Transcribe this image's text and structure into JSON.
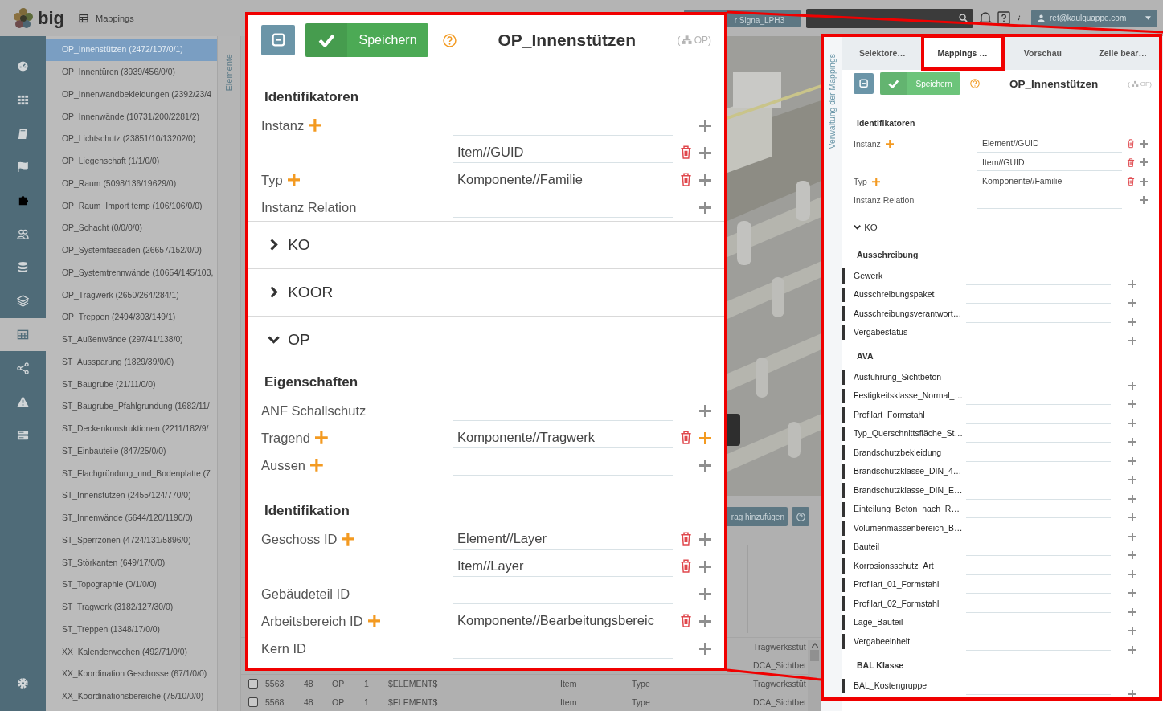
{
  "topbar": {
    "logo": "big",
    "section": "Mappings",
    "project": "r Signa_LPH3",
    "user": "ret@kaulquappe.com"
  },
  "nav": [
    {
      "selected": false
    },
    {
      "selected": false
    },
    {
      "selected": false
    },
    {
      "selected": false
    },
    {
      "selected": false
    },
    {
      "selected": false
    },
    {
      "selected": false
    },
    {
      "selected": false
    },
    {
      "selected": true
    },
    {
      "selected": false
    },
    {
      "selected": false
    },
    {
      "selected": false
    },
    {
      "selected": false
    }
  ],
  "elements": {
    "tab": "Elemente",
    "items": [
      {
        "label": "OP_Innenstützen (2472/107/0/1)",
        "selected": true
      },
      {
        "label": "OP_Innentüren (3939/456/0/0)",
        "selected": false
      },
      {
        "label": "OP_Innenwandbekleidungen (2392/23/4",
        "selected": false
      },
      {
        "label": "OP_Innenwände (10731/200/2281/2)",
        "selected": false
      },
      {
        "label": "OP_Lichtschutz (23851/10/13202/0)",
        "selected": false
      },
      {
        "label": "OP_Liegenschaft (1/1/0/0)",
        "selected": false
      },
      {
        "label": "OP_Raum (5098/136/19629/0)",
        "selected": false
      },
      {
        "label": "OP_Raum_Import temp (106/106/0/0)",
        "selected": false
      },
      {
        "label": "OP_Schacht (0/0/0/0)",
        "selected": false
      },
      {
        "label": "OP_Systemfassaden (26657/152/0/0)",
        "selected": false
      },
      {
        "label": "OP_Systemtrennwände (10654/145/103,",
        "selected": false
      },
      {
        "label": "OP_Tragwerk (2650/264/284/1)",
        "selected": false
      },
      {
        "label": "OP_Treppen (2494/303/149/1)",
        "selected": false
      },
      {
        "label": "ST_Außenwände (297/41/138/0)",
        "selected": false
      },
      {
        "label": "ST_Aussparung (1829/39/0/0)",
        "selected": false
      },
      {
        "label": "ST_Baugrube (21/11/0/0)",
        "selected": false
      },
      {
        "label": "ST_Baugrube_Pfahlgrundung (1682/11/",
        "selected": false
      },
      {
        "label": "ST_Deckenkonstruktionen (2211/182/9/",
        "selected": false
      },
      {
        "label": "ST_Einbauteile (847/25/0/0)",
        "selected": false
      },
      {
        "label": "ST_Flachgründung_und_Bodenplatte (7",
        "selected": false
      },
      {
        "label": "ST_Innenstützen (2455/124/770/0)",
        "selected": false
      },
      {
        "label": "ST_Innenwände (5644/120/1190/0)",
        "selected": false
      },
      {
        "label": "ST_Sperrzonen (4724/131/5896/0)",
        "selected": false
      },
      {
        "label": "ST_Störkanten (649/17/0/0)",
        "selected": false
      },
      {
        "label": "ST_Topographie (0/1/0/0)",
        "selected": false
      },
      {
        "label": "ST_Tragwerk (3182/127/30/0)",
        "selected": false
      },
      {
        "label": "ST_Treppen (1348/17/0/0)",
        "selected": false
      },
      {
        "label": "XX_Kalenderwochen (492/71/0/0)",
        "selected": false
      },
      {
        "label": "XX_Koordination Geschosse (67/1/0/0)",
        "selected": false
      },
      {
        "label": "XX_Koordinationsbereiche (75/10/0/0)",
        "selected": false
      }
    ]
  },
  "viewer": {
    "add_button": "rag hinzufügen"
  },
  "table": {
    "rows": [
      {
        "name": "Tragwerksstüt"
      },
      {
        "name": "DCA_Sichtbet"
      },
      {
        "checked": false,
        "id": "5563",
        "column_2": "48",
        "layer": "OP",
        "column_4": "1",
        "source": "$ELEMENT$",
        "item": "Item",
        "type": "Type",
        "name": "Tragwerksstüt"
      },
      {
        "checked": false,
        "id": "5568",
        "column_2": "48",
        "layer": "OP",
        "column_4": "1",
        "source": "$ELEMENT$",
        "item": "Item",
        "type": "Type",
        "name": "DCA_Sichtbet"
      }
    ]
  },
  "callout": {
    "title": "OP_Innenstützen",
    "save": "Speichern",
    "badge": [
      "(",
      "OP)"
    ],
    "items": [
      {
        "kind": "heading",
        "text": "Identifikatoren"
      },
      {
        "kind": "field",
        "label": "Instanz",
        "addable": true,
        "lines": [
          {
            "kind": "empty",
            "highlighted": false
          },
          {
            "kind": "value",
            "value": "Item//GUID",
            "highlighted": false
          }
        ]
      },
      {
        "kind": "field",
        "label": "Typ",
        "addable": true,
        "lines": [
          {
            "kind": "value",
            "value": "Komponente//Familie",
            "highlighted": false
          }
        ]
      },
      {
        "kind": "field",
        "label": "Instanz Relation",
        "addable": false,
        "lines": [
          {
            "kind": "empty",
            "highlighted": false
          }
        ]
      },
      {
        "kind": "group",
        "title": "KO",
        "expanded": false
      },
      {
        "kind": "group",
        "title": "KOOR",
        "expanded": false
      },
      {
        "kind": "group",
        "title": "OP",
        "expanded": true,
        "children": [
          {
            "kind": "heading",
            "text": "Eigenschaften"
          },
          {
            "kind": "field",
            "label": "ANF Schallschutz",
            "addable": false,
            "lines": [
              {
                "kind": "empty",
                "highlighted": false
              }
            ]
          },
          {
            "kind": "field",
            "label": "Tragend",
            "addable": true,
            "lines": [
              {
                "kind": "value",
                "value": "Komponente//Tragwerk",
                "highlighted": true
              }
            ]
          },
          {
            "kind": "field",
            "label": "Aussen",
            "addable": true,
            "lines": [
              {
                "kind": "empty",
                "highlighted": false
              }
            ]
          },
          {
            "kind": "heading",
            "text": "Identifikation"
          },
          {
            "kind": "field",
            "label": "Geschoss ID",
            "addable": true,
            "lines": [
              {
                "kind": "value",
                "value": "Element//Layer",
                "highlighted": false
              },
              {
                "kind": "value",
                "value": "Item//Layer",
                "highlighted": false
              }
            ]
          },
          {
            "kind": "field",
            "label": "Gebäudeteil ID",
            "addable": false,
            "lines": [
              {
                "kind": "empty",
                "highlighted": false
              }
            ]
          },
          {
            "kind": "field",
            "label": "Arbeitsbereich ID",
            "addable": true,
            "lines": [
              {
                "kind": "value",
                "value": "Komponente//Bearbeitungsbereic",
                "highlighted": false
              }
            ]
          },
          {
            "kind": "field",
            "label": "Kern ID",
            "addable": false,
            "lines": [
              {
                "kind": "empty",
                "highlighted": false
              }
            ]
          }
        ]
      }
    ]
  },
  "panel": {
    "side_tab": "Verwaltung der Mappings",
    "tabs": [
      {
        "label": "Selektore…",
        "selected": false
      },
      {
        "label": "Mappings …",
        "selected": true
      },
      {
        "label": "Vorschau",
        "selected": false
      },
      {
        "label": "Zeile bear…",
        "selected": false
      }
    ],
    "title": "OP_Innenstützen",
    "save": "Speichern",
    "badge": [
      "(",
      "OP)"
    ],
    "items": [
      {
        "kind": "heading",
        "text": "Identifikatoren"
      },
      {
        "kind": "field",
        "label": "Instanz",
        "addable": true,
        "lines": [
          {
            "kind": "value",
            "value": "Element//GUID",
            "highlighted": false
          },
          {
            "kind": "value",
            "value": "Item//GUID",
            "highlighted": false
          }
        ]
      },
      {
        "kind": "field",
        "label": "Typ",
        "addable": true,
        "lines": [
          {
            "kind": "value",
            "value": "Komponente//Familie",
            "highlighted": false
          }
        ]
      },
      {
        "kind": "field",
        "label": "Instanz Relation",
        "addable": false,
        "lines": [
          {
            "kind": "empty",
            "highlighted": false
          }
        ]
      },
      {
        "kind": "group",
        "title": "KO",
        "expanded": true,
        "children": [
          {
            "kind": "heading",
            "text": "Ausschreibung"
          },
          {
            "kind": "attribute",
            "label": "Gewerk"
          },
          {
            "kind": "attribute",
            "label": "Ausschreibungspaket"
          },
          {
            "kind": "attribute",
            "label": "Ausschreibungsverantwort…"
          },
          {
            "kind": "attribute",
            "label": "Vergabestatus"
          },
          {
            "kind": "heading",
            "text": "AVA"
          },
          {
            "kind": "attribute",
            "label": "Ausführung_Sichtbeton"
          },
          {
            "kind": "attribute",
            "label": "Festigkeitsklasse_Normal_…"
          },
          {
            "kind": "attribute",
            "label": "Profilart_Formstahl"
          },
          {
            "kind": "attribute",
            "label": "Typ_Querschnittsfläche_St…"
          },
          {
            "kind": "attribute",
            "label": "Brandschutzbekleidung"
          },
          {
            "kind": "attribute",
            "label": "Brandschutzklasse_DIN_4…"
          },
          {
            "kind": "attribute",
            "label": "Brandschutzklasse_DIN_E…"
          },
          {
            "kind": "attribute",
            "label": "Einteilung_Beton_nach_R…"
          },
          {
            "kind": "attribute",
            "label": "Volumenmassenbereich_B…"
          },
          {
            "kind": "attribute",
            "label": "Bauteil"
          },
          {
            "kind": "attribute",
            "label": "Korrosionsschutz_Art"
          },
          {
            "kind": "attribute",
            "label": "Profilart_01_Formstahl"
          },
          {
            "kind": "attribute",
            "label": "Profilart_02_Formstahl"
          },
          {
            "kind": "attribute",
            "label": "Lage_Bauteil"
          },
          {
            "kind": "attribute",
            "label": "Vergabeeinheit"
          },
          {
            "kind": "heading",
            "text": "BAL Klasse"
          },
          {
            "kind": "attribute",
            "label": "BAL_Kostengruppe"
          }
        ]
      }
    ]
  }
}
